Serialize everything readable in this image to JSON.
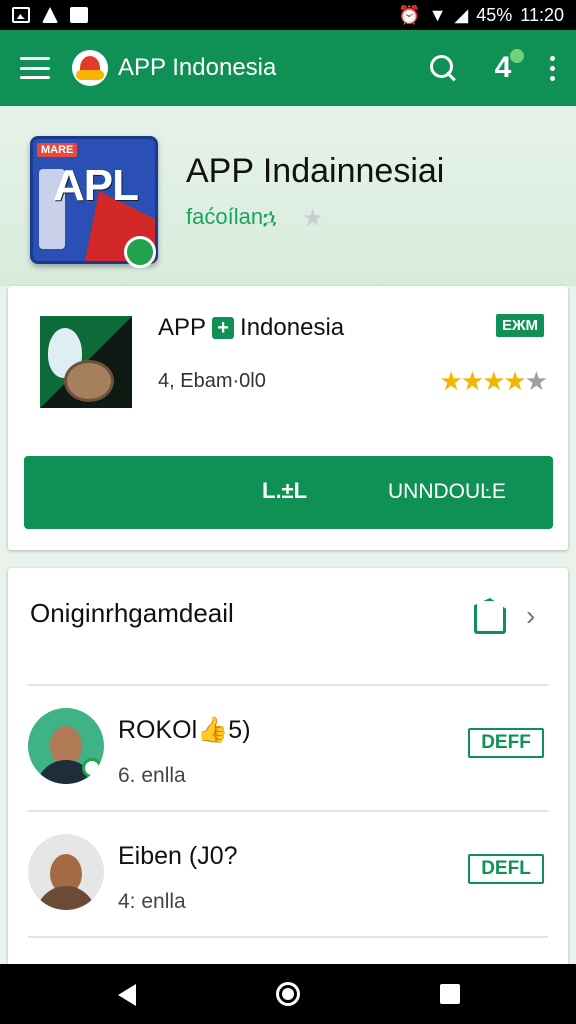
{
  "status_bar": {
    "battery_text": "45%",
    "time": "11:20"
  },
  "app_bar": {
    "title": "APP Indonesia",
    "notification_glyph": "4"
  },
  "hero": {
    "icon_label": "APL",
    "icon_tag": "MARE",
    "title": "APP Indainnesiai",
    "subtitle": "faćoílanኋ"
  },
  "item": {
    "title_left": "APP",
    "title_plus": "+",
    "title_right": "Indonesia",
    "badge": "ЕЖМ",
    "meta": "4, Ebam·0l0",
    "rating_stars_filled": 4,
    "rating_stars_total": 5,
    "button_left": "L.±L",
    "button_right": "UNNDOUĿE"
  },
  "section": {
    "title": "Oniginrhgamdeail",
    "items": [
      {
        "name": "RОKОl👍5)",
        "sub": "6. enlla",
        "action": "DEFF"
      },
      {
        "name": "Eiben (J0?",
        "sub": "4: enlla",
        "action": "DEFL"
      }
    ]
  },
  "colors": {
    "primary": "#0f9155",
    "star": "#f4b400"
  }
}
